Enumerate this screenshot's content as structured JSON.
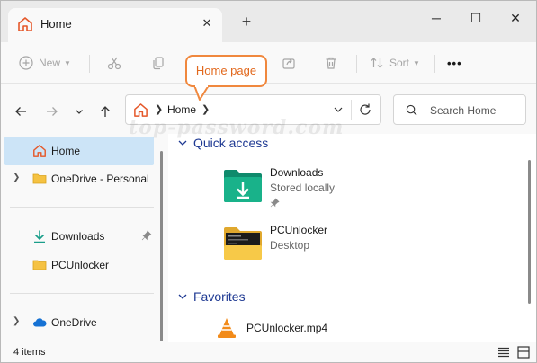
{
  "tab": {
    "title": "Home",
    "close_glyph": "✕",
    "new_tab_glyph": "+"
  },
  "window_controls": {
    "minimize": "─",
    "maximize": "☐",
    "close": "✕"
  },
  "toolbar": {
    "new_label": "New",
    "sort_label": "Sort",
    "more_glyph": "•••"
  },
  "callout": {
    "text": "Home page"
  },
  "address": {
    "crumb": "Home"
  },
  "search": {
    "placeholder": "Search Home"
  },
  "watermark": "top-password.com",
  "sidebar": {
    "items": [
      {
        "label": "Home",
        "icon": "home-icon",
        "active": true
      },
      {
        "label": "OneDrive - Personal",
        "icon": "folder-icon"
      },
      {
        "label": "Downloads",
        "icon": "download-icon",
        "pinned": true
      },
      {
        "label": "PCUnlocker",
        "icon": "folder-icon"
      },
      {
        "label": "OneDrive",
        "icon": "cloud-icon"
      }
    ]
  },
  "main": {
    "quick_access_title": "Quick access",
    "quick_access": [
      {
        "name": "Downloads",
        "sub": "Stored locally",
        "pinned": true,
        "icon": "downloads-folder-icon"
      },
      {
        "name": "PCUnlocker",
        "sub": "Desktop",
        "icon": "pcunlocker-folder-icon"
      }
    ],
    "favorites_title": "Favorites",
    "favorites": [
      {
        "name": "PCUnlocker.mp4",
        "icon": "vlc-icon"
      }
    ]
  },
  "status": {
    "count": "4 items"
  },
  "colors": {
    "accent": "#1f3a93",
    "callout": "#f0883e",
    "selection": "#cce4f7"
  }
}
